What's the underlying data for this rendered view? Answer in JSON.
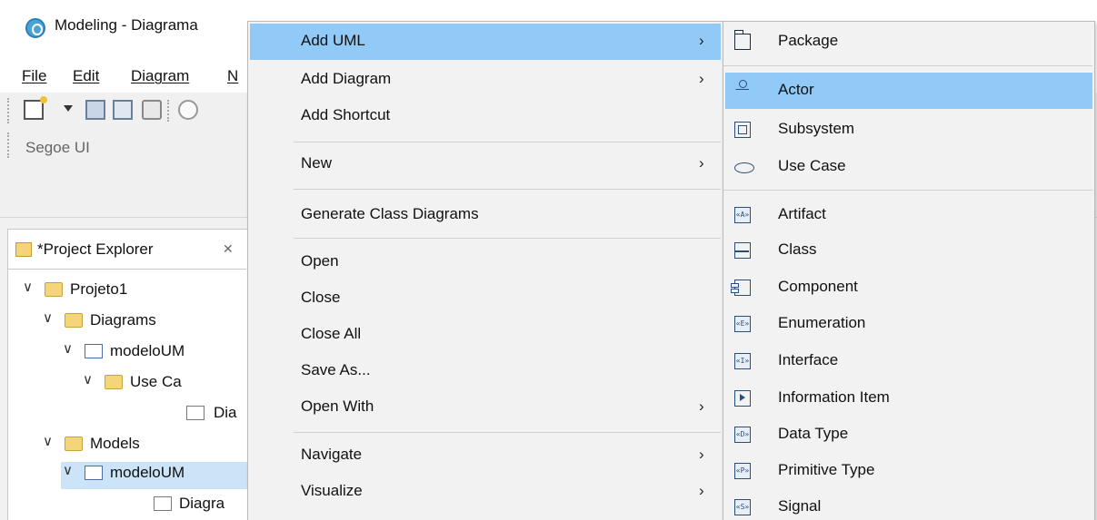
{
  "window": {
    "title": "Modeling - Diagrama"
  },
  "menubar": {
    "items": [
      "File",
      "Edit",
      "Diagram",
      "N"
    ]
  },
  "font_toolbar": {
    "font_name": "Segoe UI"
  },
  "project_explorer": {
    "tab_label": "*Project Explorer",
    "close_glyph": "✕",
    "tree": [
      {
        "label": "Projeto1",
        "chevron": "∨"
      },
      {
        "label": "Diagrams",
        "chevron": "∨"
      },
      {
        "label": "modeloUM",
        "chevron": "∨"
      },
      {
        "label": "Use Ca",
        "chevron": "∨"
      },
      {
        "label": "Dia",
        "chevron": ""
      },
      {
        "label": "Models",
        "chevron": "∨"
      },
      {
        "label": "modeloUM",
        "chevron": "∨"
      },
      {
        "label": "Diagra",
        "chevron": ""
      }
    ]
  },
  "context_menu": {
    "items": [
      {
        "label": "Add UML",
        "has_submenu": true,
        "highlighted": true
      },
      {
        "label": "Add Diagram",
        "has_submenu": true
      },
      {
        "label": "Add Shortcut",
        "has_submenu": false
      },
      {
        "label": "New",
        "has_submenu": true
      },
      {
        "label": "Generate Class Diagrams",
        "has_submenu": false
      },
      {
        "label": "Open",
        "has_submenu": false
      },
      {
        "label": "Close",
        "has_submenu": false
      },
      {
        "label": "Close All",
        "has_submenu": false
      },
      {
        "label": "Save As...",
        "has_submenu": false
      },
      {
        "label": "Open With",
        "has_submenu": true
      },
      {
        "label": "Navigate",
        "has_submenu": true
      },
      {
        "label": "Visualize",
        "has_submenu": true
      }
    ],
    "submenu_arrow": "›"
  },
  "submenu": {
    "items": [
      {
        "label": "Package",
        "icon": "package-icon"
      },
      {
        "label": "Actor",
        "icon": "actor-icon",
        "highlighted": true
      },
      {
        "label": "Subsystem",
        "icon": "subsystem-icon"
      },
      {
        "label": "Use Case",
        "icon": "use-case-icon"
      },
      {
        "label": "Artifact",
        "icon": "artifact-icon",
        "glyph": "«A»"
      },
      {
        "label": "Class",
        "icon": "class-icon"
      },
      {
        "label": "Component",
        "icon": "component-icon"
      },
      {
        "label": "Enumeration",
        "icon": "enumeration-icon",
        "glyph": "«E»"
      },
      {
        "label": "Interface",
        "icon": "interface-icon",
        "glyph": "«I»"
      },
      {
        "label": "Information Item",
        "icon": "information-item-icon"
      },
      {
        "label": "Data Type",
        "icon": "data-type-icon",
        "glyph": "«D»"
      },
      {
        "label": "Primitive Type",
        "icon": "primitive-type-icon",
        "glyph": "«P»"
      },
      {
        "label": "Signal",
        "icon": "signal-icon",
        "glyph": "«S»"
      }
    ]
  },
  "colors": {
    "highlight": "#91c9f7",
    "menu_bg": "#f2f2f2",
    "selection": "#cce4f7"
  }
}
